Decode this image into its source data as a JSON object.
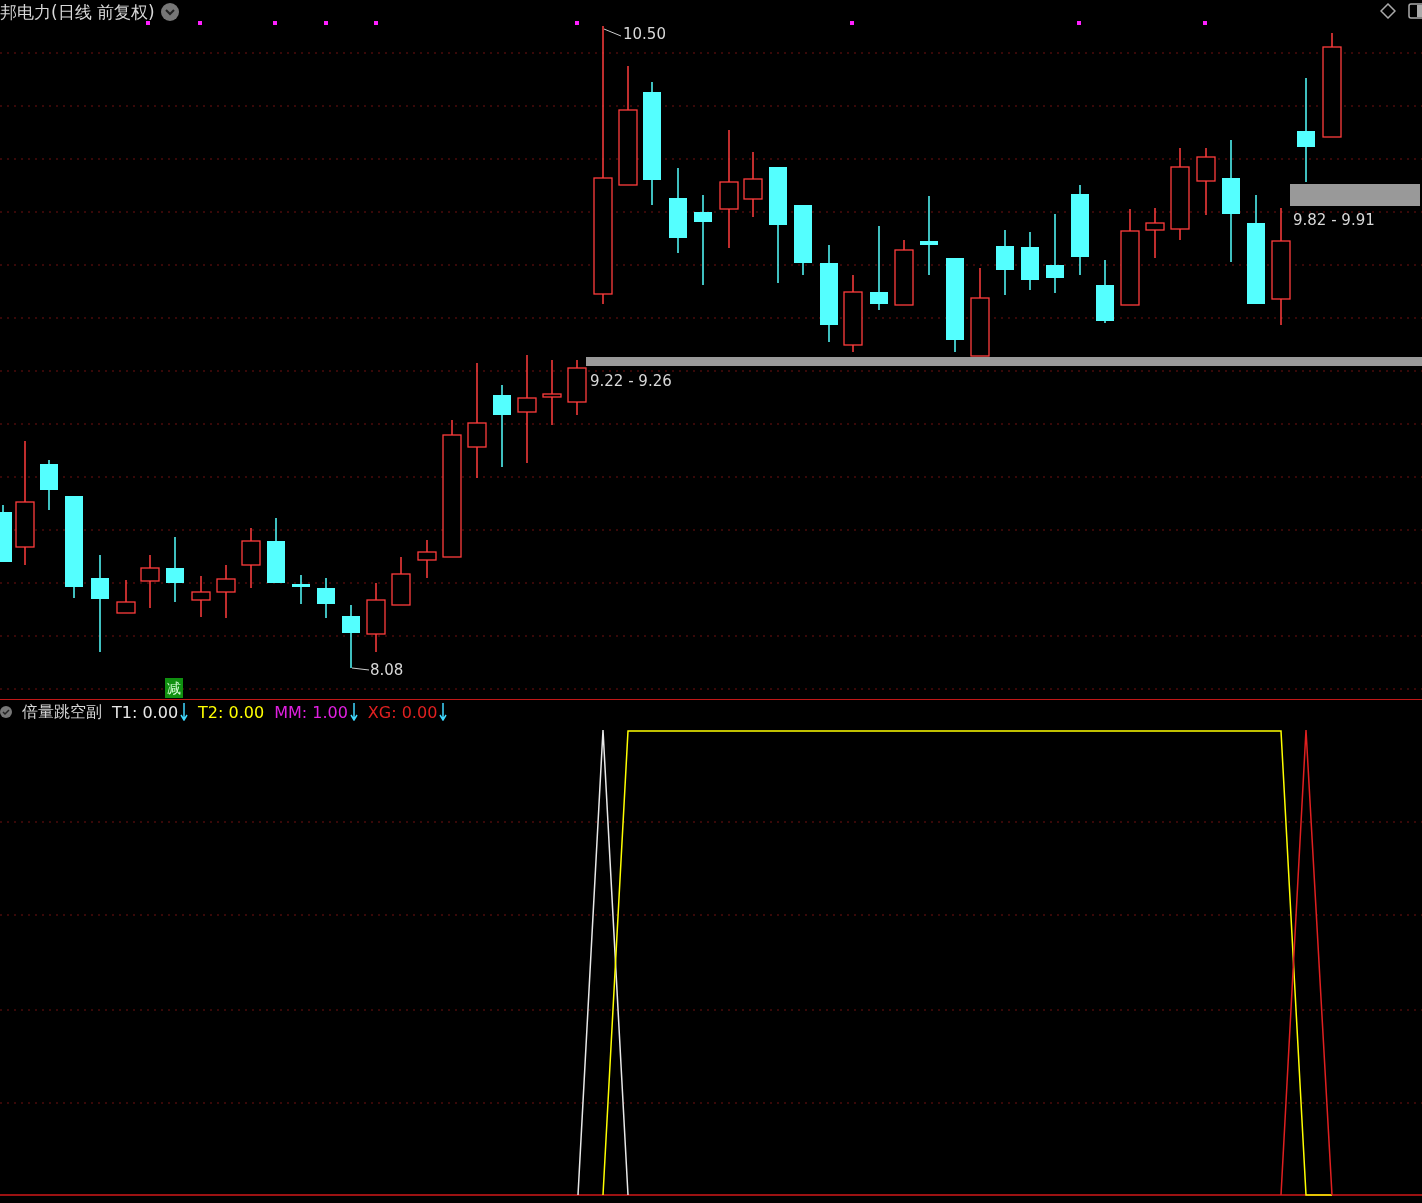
{
  "title": {
    "text": "邦电力(日线 前复权)"
  },
  "price_labels": [
    {
      "kind": "high",
      "text": "10.50"
    },
    {
      "kind": "low",
      "text": "8.08"
    },
    {
      "kind": "zone",
      "text": "9.22 - 9.26"
    },
    {
      "kind": "zone",
      "text": "9.82 - 9.91"
    }
  ],
  "signal_tag": "减",
  "indicator": {
    "name": "倍量跳空副",
    "values": [
      {
        "label": "T1:",
        "value": "0.00",
        "color": "#e8e8e8",
        "arrow": true
      },
      {
        "label": "T2:",
        "value": "0.00",
        "color": "#ffff00",
        "arrow": false
      },
      {
        "label": "MM:",
        "value": "1.00",
        "color": "#e020e0",
        "arrow": true
      },
      {
        "label": "XG:",
        "value": "0.00",
        "color": "#e02020",
        "arrow": true
      }
    ]
  }
}
